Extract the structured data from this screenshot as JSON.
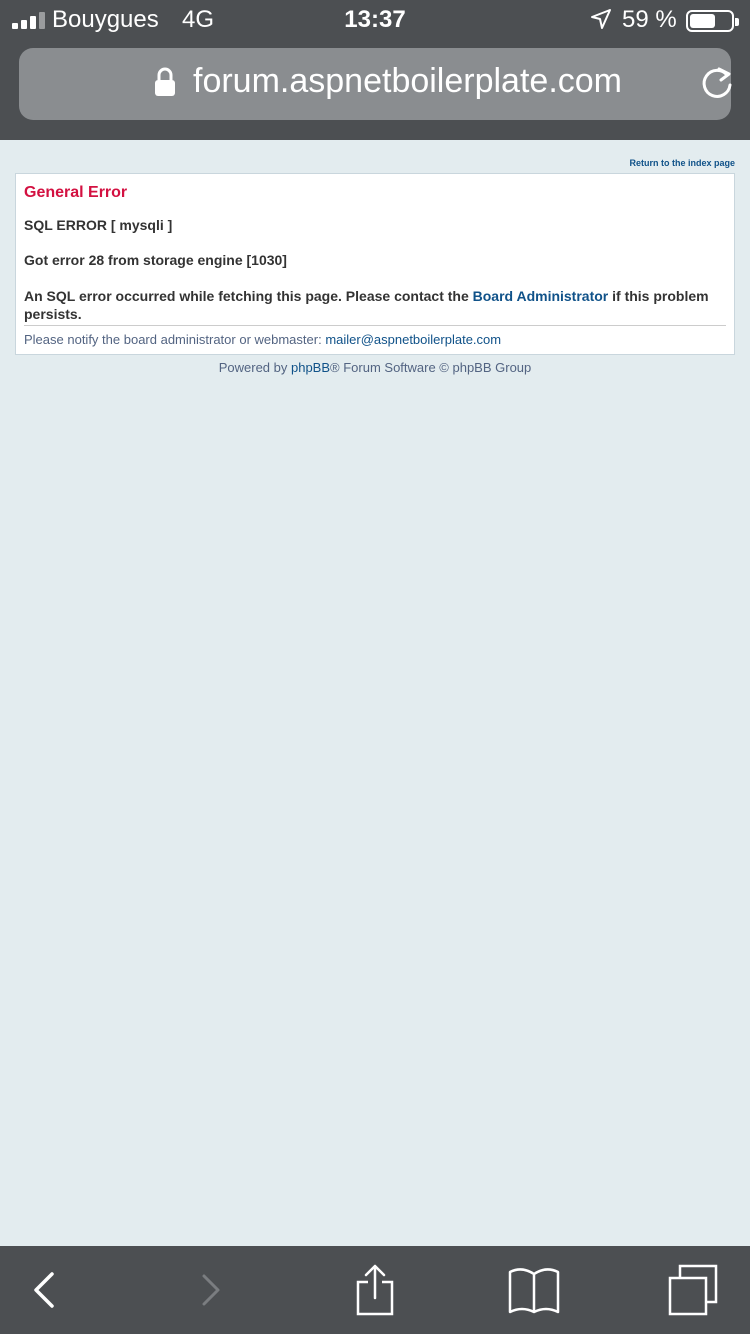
{
  "status": {
    "carrier": "Bouygues",
    "network": "4G",
    "time": "13:37",
    "battery_percent": "59 %",
    "battery_level": 0.59
  },
  "browser": {
    "url": "forum.aspnetboilerplate.com"
  },
  "page": {
    "index_link": "Return to the index page",
    "error_title": "General Error",
    "sql_error": "SQL ERROR [ mysqli ]",
    "error_detail": "Got error 28 from storage engine [1030]",
    "message_prefix": "An SQL error occurred while fetching this page. Please contact the ",
    "message_link": "Board Administrator",
    "message_suffix": " if this problem persists.",
    "notify_text": "Please notify the board administrator or webmaster: ",
    "notify_email": "mailer@aspnetboilerplate.com",
    "powered_prefix": "Powered by ",
    "powered_link": "phpBB",
    "powered_suffix": "® Forum Software © phpBB Group"
  },
  "toolbar": {
    "icons": [
      "back-icon",
      "forward-icon",
      "share-icon",
      "bookmarks-icon",
      "tabs-icon"
    ]
  },
  "colors": {
    "chrome": "#4c4f52",
    "url_bar": "#8a8d90",
    "page_bg": "#e3ecef",
    "error_title": "#d31141",
    "link": "#105289"
  }
}
